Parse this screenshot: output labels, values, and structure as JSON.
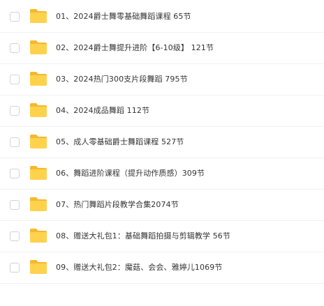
{
  "colors": {
    "folder_body": "#ffd24d",
    "folder_tab": "#f5b82e",
    "row_divider": "#f1f2f4",
    "text": "#333333",
    "checkbox_border": "#cfd3da"
  },
  "icon": "folder-icon",
  "files": [
    {
      "name": "01、2024爵士舞零基础舞蹈课程 65节"
    },
    {
      "name": "02、2024爵士舞提升进阶【6-10级】 121节"
    },
    {
      "name": "03、2024热门300支片段舞蹈 795节"
    },
    {
      "name": "04、2024成品舞蹈 112节"
    },
    {
      "name": "05、成人零基础爵士舞蹈课程 527节"
    },
    {
      "name": "06、舞蹈进阶课程（提升动作质感）309节"
    },
    {
      "name": "07、热门舞蹈片段教学合集2074节"
    },
    {
      "name": "08、赠送大礼包1：基础舞蹈拍摄与剪辑教学 56节"
    },
    {
      "name": "09、赠送大礼包2：魔菇、会会、雅婷儿1069节"
    }
  ]
}
